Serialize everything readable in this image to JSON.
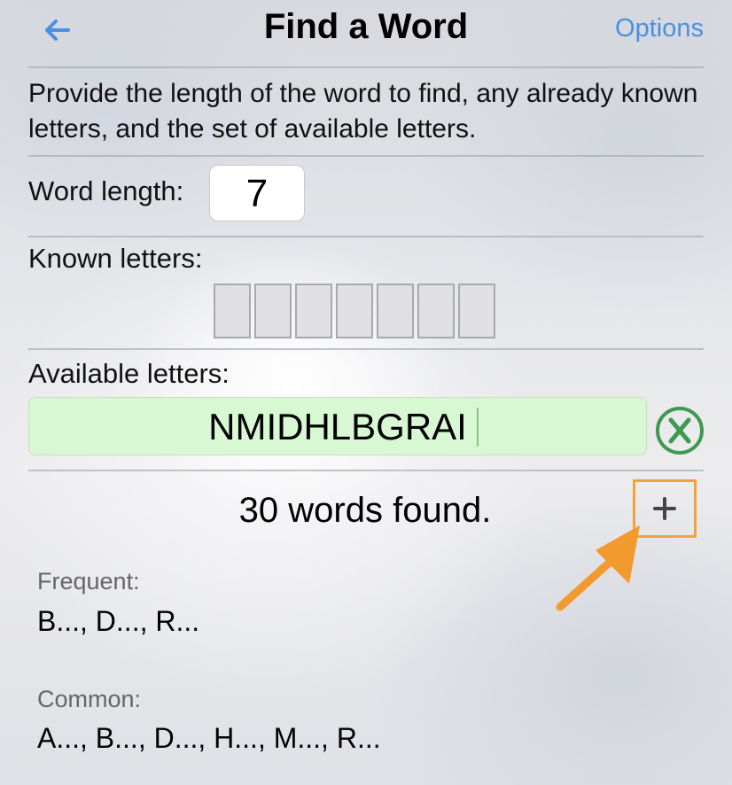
{
  "header": {
    "title": "Find a Word",
    "back_icon": "arrow-left-icon",
    "options_label": "Options"
  },
  "instructions": "Provide the length of the word to find, any already known letters, and the set of available letters.",
  "word_length": {
    "label": "Word length:",
    "value": "7"
  },
  "known_letters": {
    "label": "Known letters:",
    "boxes": [
      "",
      "",
      "",
      "",
      "",
      "",
      ""
    ]
  },
  "available_letters": {
    "label": "Available letters:",
    "value": "NMIDHLBGRAI",
    "clear_icon": "clear-x-circle-icon"
  },
  "results": {
    "count_text": "30 words found.",
    "expand_icon": "plus-icon",
    "annotation_icon": "orange-arrow-pointer-icon"
  },
  "sections": [
    {
      "label": "Frequent:",
      "words": "B..., D..., R..."
    },
    {
      "label": "Common:",
      "words": "A..., B..., D..., H..., M..., R..."
    }
  ],
  "colors": {
    "accent_blue": "#4a90e2",
    "available_field_bg": "#d8f7d3",
    "clear_button_green": "#3d9a4e",
    "highlight_orange": "#f3a23a"
  }
}
